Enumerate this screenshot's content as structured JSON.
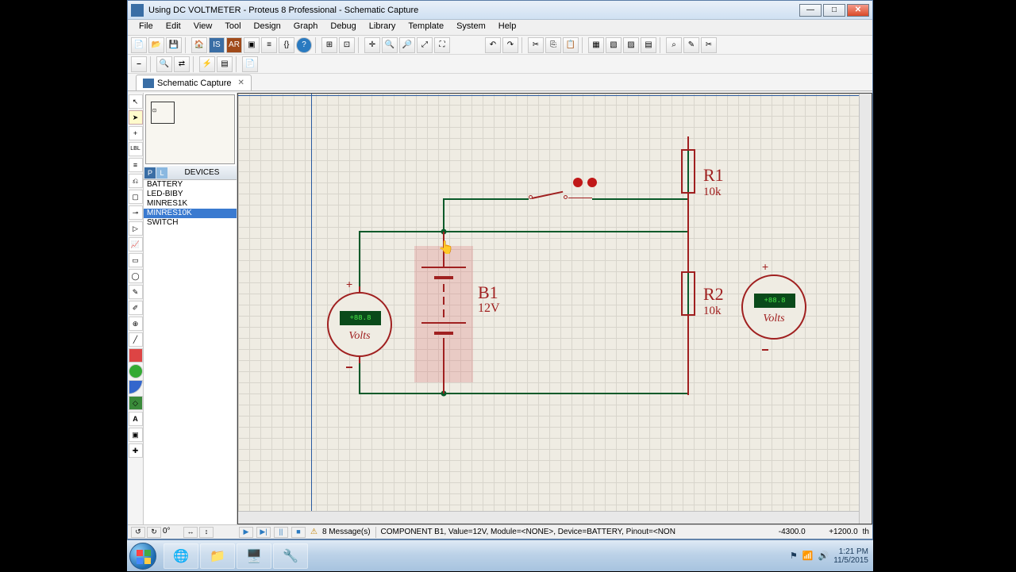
{
  "window": {
    "title": "Using DC VOLTMETER - Proteus 8 Professional - Schematic Capture"
  },
  "menu": [
    "File",
    "Edit",
    "View",
    "Tool",
    "Design",
    "Graph",
    "Debug",
    "Library",
    "Template",
    "System",
    "Help"
  ],
  "tab": {
    "label": "Schematic Capture"
  },
  "devices": {
    "header": "DEVICES",
    "items": [
      "BATTERY",
      "LED-BIBY",
      "MINRES1K",
      "MINRES10K",
      "SWITCH"
    ],
    "selected": "MINRES10K"
  },
  "schematic": {
    "battery": {
      "ref": "B1",
      "value": "12V"
    },
    "r1": {
      "ref": "R1",
      "value": "10k"
    },
    "r2": {
      "ref": "R2",
      "value": "10k"
    },
    "voltmeter_left": {
      "reading": "+88.8",
      "unit": "Volts"
    },
    "voltmeter_right": {
      "reading": "+88.8",
      "unit": "Volts"
    }
  },
  "status": {
    "rotation": "0°",
    "messages": "8 Message(s)",
    "info": "COMPONENT B1, Value=12V, Module=<NONE>, Device=BATTERY, Pinout=<NON",
    "coord_x": "-4300.0",
    "coord_y": "+1200.0",
    "units": "th"
  },
  "tray": {
    "time": "1:21 PM",
    "date": "11/5/2015"
  }
}
